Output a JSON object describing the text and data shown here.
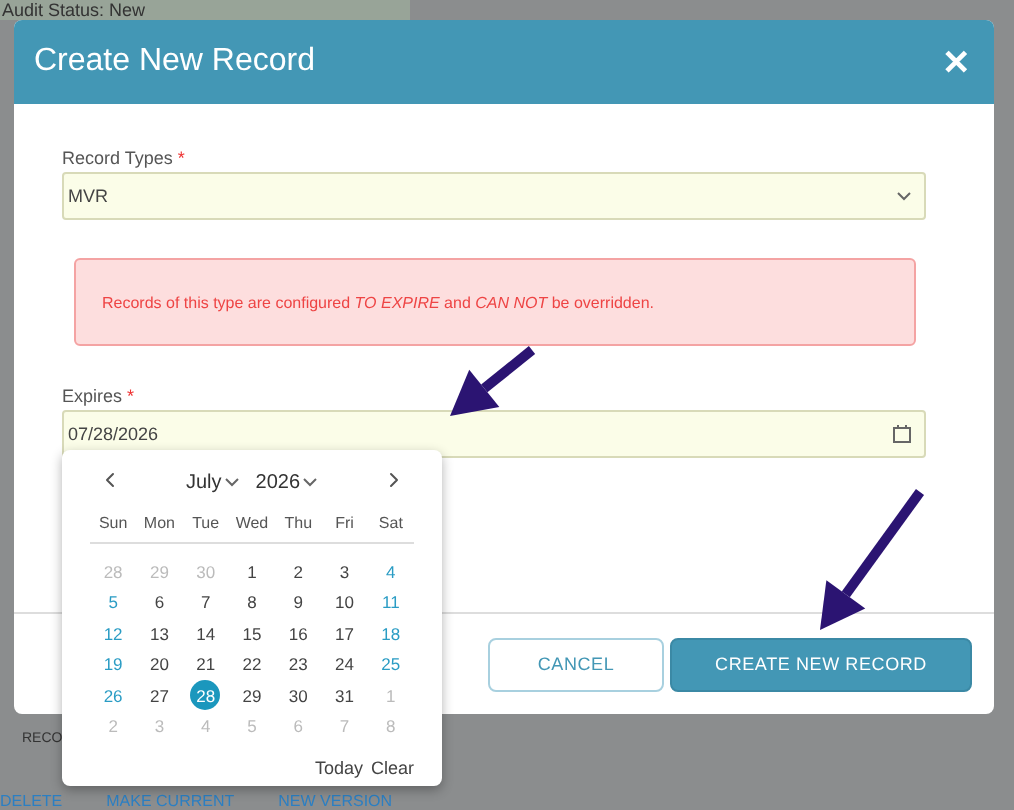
{
  "background": {
    "status": "Audit Status: New",
    "section_label": "RECO",
    "links": [
      "DELETE",
      "MAKE CURRENT",
      "NEW VERSION"
    ]
  },
  "dialog": {
    "title": "Create New Record",
    "close": "✕",
    "record_type": {
      "label": "Record Types",
      "required_mark": "*",
      "value": "MVR"
    },
    "alert": "Records of this type are configured *TO EXPIRE* and *CAN NOT* be overridden.",
    "expires": {
      "label": "Expires",
      "required_mark": "*",
      "value": "07/28/2026"
    },
    "buttons": [
      {
        "label": "CANCEL",
        "kind": "secondary"
      },
      {
        "label": "CREATE NEW RECORD",
        "kind": "primary"
      }
    ]
  },
  "datepicker": {
    "month": "July",
    "year": "2026",
    "weekdays": [
      "Sun",
      "Mon",
      "Tue",
      "Wed",
      "Thu",
      "Fri",
      "Sat"
    ],
    "days": [
      {
        "label": "28",
        "kind": "outside",
        "selected": false
      },
      {
        "label": "29",
        "kind": "outside",
        "selected": false
      },
      {
        "label": "30",
        "kind": "outside",
        "selected": false
      },
      {
        "label": "1",
        "kind": "weekday",
        "selected": false
      },
      {
        "label": "2",
        "kind": "weekday",
        "selected": false
      },
      {
        "label": "3",
        "kind": "weekday",
        "selected": false
      },
      {
        "label": "4",
        "kind": "weekend",
        "selected": false
      },
      {
        "label": "5",
        "kind": "weekend",
        "selected": false
      },
      {
        "label": "6",
        "kind": "weekday",
        "selected": false
      },
      {
        "label": "7",
        "kind": "weekday",
        "selected": false
      },
      {
        "label": "8",
        "kind": "weekday",
        "selected": false
      },
      {
        "label": "9",
        "kind": "weekday",
        "selected": false
      },
      {
        "label": "10",
        "kind": "weekday",
        "selected": false
      },
      {
        "label": "11",
        "kind": "weekend",
        "selected": false
      },
      {
        "label": "12",
        "kind": "weekend",
        "selected": false
      },
      {
        "label": "13",
        "kind": "weekday",
        "selected": false
      },
      {
        "label": "14",
        "kind": "weekday",
        "selected": false
      },
      {
        "label": "15",
        "kind": "weekday",
        "selected": false
      },
      {
        "label": "16",
        "kind": "weekday",
        "selected": false
      },
      {
        "label": "17",
        "kind": "weekday",
        "selected": false
      },
      {
        "label": "18",
        "kind": "weekend",
        "selected": false
      },
      {
        "label": "19",
        "kind": "weekend",
        "selected": false
      },
      {
        "label": "20",
        "kind": "weekday",
        "selected": false
      },
      {
        "label": "21",
        "kind": "weekday",
        "selected": false
      },
      {
        "label": "22",
        "kind": "weekday",
        "selected": false
      },
      {
        "label": "23",
        "kind": "weekday",
        "selected": false
      },
      {
        "label": "24",
        "kind": "weekday",
        "selected": false
      },
      {
        "label": "25",
        "kind": "weekend",
        "selected": false
      },
      {
        "label": "26",
        "kind": "weekend",
        "selected": false
      },
      {
        "label": "27",
        "kind": "weekday",
        "selected": false
      },
      {
        "label": "28",
        "kind": "weekday",
        "selected": true
      },
      {
        "label": "29",
        "kind": "weekday",
        "selected": false
      },
      {
        "label": "30",
        "kind": "weekday",
        "selected": false
      },
      {
        "label": "31",
        "kind": "weekday",
        "selected": false
      },
      {
        "label": "1",
        "kind": "outside",
        "selected": false
      },
      {
        "label": "2",
        "kind": "outside",
        "selected": false
      },
      {
        "label": "3",
        "kind": "outside",
        "selected": false
      },
      {
        "label": "4",
        "kind": "outside",
        "selected": false
      },
      {
        "label": "5",
        "kind": "outside",
        "selected": false
      },
      {
        "label": "6",
        "kind": "outside",
        "selected": false
      },
      {
        "label": "7",
        "kind": "outside",
        "selected": false
      },
      {
        "label": "8",
        "kind": "outside",
        "selected": false
      }
    ],
    "actions": [
      "Today",
      "Clear"
    ]
  }
}
